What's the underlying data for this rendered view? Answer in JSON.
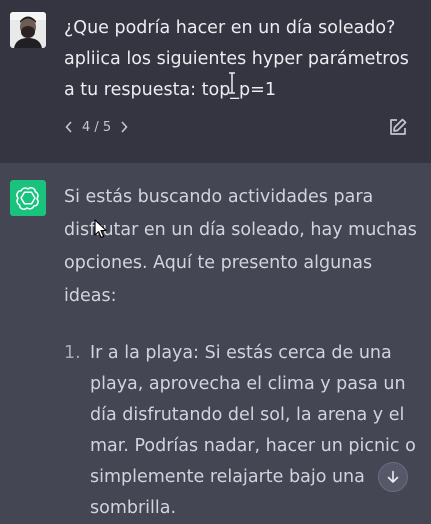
{
  "user_message": {
    "text": "¿Que podría hacer en un día soleado? apliica los siguientes hyper parámetros a tu respuesta: top_p=1",
    "pager": {
      "prev_icon": "chevron-left-icon",
      "label": "4 / 5",
      "next_icon": "chevron-right-icon"
    },
    "edit_icon": "edit-icon"
  },
  "assistant_message": {
    "intro": "Si estás buscando actividades para disfrutar en un día soleado, hay muchas opciones. Aquí te presento algunas ideas:",
    "list": [
      {
        "number": "1.",
        "text": "Ir a la playa: Si estás cerca de una playa, aprovecha el clima y pasa un día disfrutando del sol, la arena y el mar. Podrías nadar, hacer un picnic o simplemente relajarte bajo una sombrilla."
      }
    ]
  },
  "scroll_button_icon": "arrow-down-icon",
  "colors": {
    "user_bg": "#343541",
    "assistant_bg": "#444654",
    "gpt_green": "#19c37d"
  }
}
